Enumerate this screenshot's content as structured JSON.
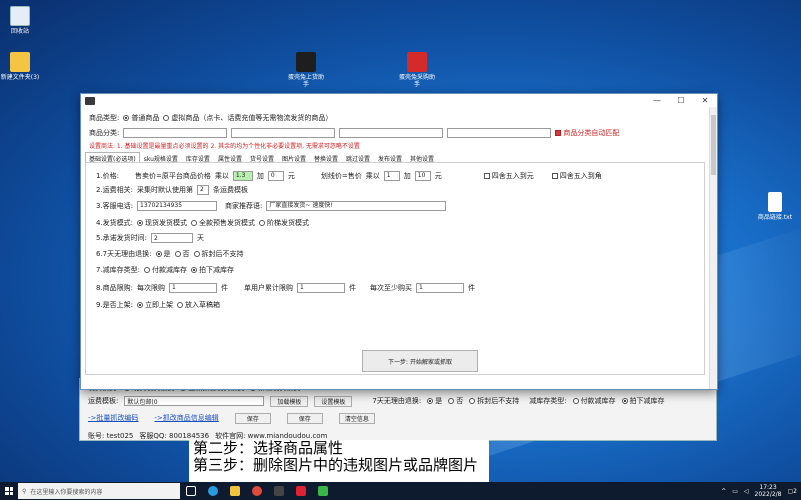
{
  "desktop": {
    "icons": [
      {
        "label": "回收站",
        "color": "#e5eef7"
      },
      {
        "label": "新建文件夹(3)",
        "color": "#f4c542"
      },
      {
        "label": "蛋壳兔上货助手",
        "color": "#1e1e1e"
      },
      {
        "label": "蛋壳兔采购助手",
        "color": "#d42a2a"
      },
      {
        "label": "商品链接.txt",
        "color": "#ffffff"
      }
    ]
  },
  "dialog": {
    "title": "",
    "controls": {
      "minimize": "—",
      "maximize": "☐",
      "close": "✕"
    },
    "product_type_label": "商品类型:",
    "product_type_options": [
      "普通商品",
      "虚拟商品（点卡、话费充值等无需物流发货的商品）"
    ],
    "product_category_label": "商品分类:",
    "auto_match_label": "商品分类自动匹配",
    "notice": "设置商法: 1. 基础设置是最量重点必须设置的  2. 其余的均为个性化非必要设置项, 无需求可忽略不设置",
    "tabs": [
      "基础设置(必选项)",
      "sku规格设置",
      "库存设置",
      "属性设置",
      "货号设置",
      "图片设置",
      "替换设置",
      "跳过设置",
      "发布设置",
      "其他设置"
    ],
    "price": {
      "label": "1.价格:",
      "text1": "售卖价=原平台商品价格",
      "mult": "乘以",
      "mult_val": "1.3",
      "add": "加",
      "add_val": "0",
      "yuan": "元",
      "text2": "划线价=售价",
      "mult2_val": "1",
      "add2_val": "10",
      "round1": "四舍五入到元",
      "round2": "四舍五入到角"
    },
    "shipping": {
      "label": "2.运费相关:",
      "text": "采集时默认使用第",
      "val": "2",
      "suffix": "条运费模板"
    },
    "contact": {
      "label": "3.客服电话:",
      "phone": "13702134935",
      "recommend_label": "商家推荐语:",
      "recommend": "厂家直接发货~ 速度快!"
    },
    "ship_mode": {
      "label": "4.发货模式:",
      "options": [
        "现货发货模式",
        "全款预售发货模式",
        "阶梯发货模式"
      ]
    },
    "ship_time": {
      "label": "5.承诺发货时间:",
      "value": "2",
      "unit": "天"
    },
    "return7": {
      "label": "6.7天无理由退换:",
      "options": [
        "是",
        "否",
        "拆封后不支持"
      ]
    },
    "stock_type": {
      "label": "7.减库存类型:",
      "options": [
        "付款减库存",
        "拍下减库存"
      ]
    },
    "limit": {
      "label": "8.商品限购:",
      "per": "每次限购",
      "per_val": "1",
      "unit": "件",
      "user": "单用户累计限购",
      "user_val": "1",
      "min": "每次至少购买",
      "min_val": "1"
    },
    "listing": {
      "label": "9.是否上架:",
      "options": [
        "立即上架",
        "放入草稿箱"
      ]
    },
    "next_button": "下一步: 开始解家或抓取"
  },
  "bg_window": {
    "ship_mode_label": "发货模式:",
    "ship_mode_options": [
      "现货发货模式",
      "全款预售发货模式",
      "阶梯发货模式"
    ],
    "freight_label": "运费模板:",
    "freight_value": "默认包邮(0",
    "load_template": "加载模板",
    "set_template": "设置模板",
    "return_label": "7天无理由退换:",
    "return_options": [
      "是",
      "否",
      "拆封后不支持"
    ],
    "stock_label": "减库存类型:",
    "stock_options": [
      "付款减库存",
      "拍下减库存"
    ],
    "link1": "->批量抓改编码",
    "link2": "->抓改商品信息编辑",
    "save": "保存",
    "save2": "保存",
    "clear": "清空信息",
    "account": "账号: test025",
    "qq": "客服QQ: 800184536",
    "website": "软件官网: www.miandoudou.com"
  },
  "subtitles": [
    "第二步：选择商品属性",
    "第三步：删除图片中的违规图片或品牌图片"
  ],
  "taskbar": {
    "search_placeholder": "在这里输入你要搜索的内容",
    "time": "17:23",
    "date": "2022/2/8",
    "notify": "2"
  }
}
